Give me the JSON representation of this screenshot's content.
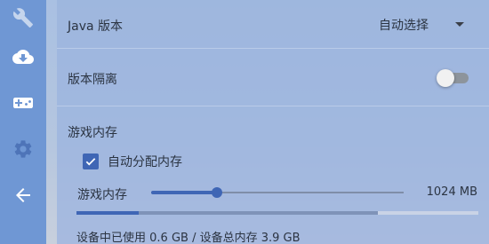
{
  "sidebar": {
    "items": [
      {
        "icon": "wrench-icon",
        "active": true
      },
      {
        "icon": "cloud-download-icon",
        "active": false
      },
      {
        "icon": "gamepad-icon",
        "active": false
      },
      {
        "icon": "gear-icon",
        "active": false
      },
      {
        "icon": "arrow-left-icon",
        "active": false
      }
    ]
  },
  "java": {
    "label": "Java 版本",
    "selected": "自动选择"
  },
  "isolation": {
    "label": "版本隔离",
    "enabled": false
  },
  "memory": {
    "section_title": "游戏内存",
    "auto_allocate_label": "自动分配内存",
    "auto_allocate_checked": true,
    "slider_label": "游戏内存",
    "slider_fraction": 0.26,
    "slider_value": "1024 MB",
    "usage_used_fraction": 0.154,
    "usage_allocated_fraction": 0.75,
    "usage_text": "设备中已使用 0.6 GB / 设备总内存 3.9 GB"
  },
  "colors": {
    "accent": "#3f66b5",
    "sidebar": "#6f97d4"
  }
}
